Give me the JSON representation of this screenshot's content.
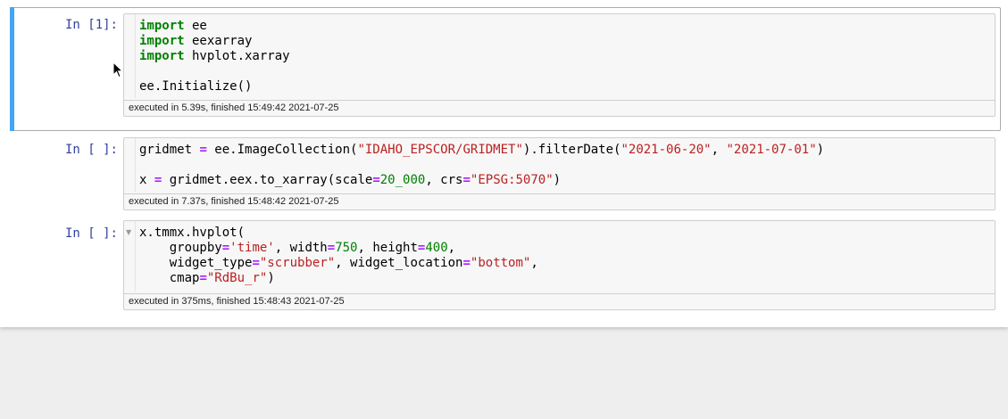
{
  "colors": {
    "prompt": "#303f9f",
    "keyword": "#008000",
    "operator": "#aa22ff",
    "string": "#ba2121",
    "number": "#008000",
    "selection_bar": "#42a5f5"
  },
  "cells": [
    {
      "prompt": "In [1]:",
      "selected": true,
      "lines": [
        [
          {
            "t": "import",
            "c": "kw"
          },
          {
            "t": " ee"
          }
        ],
        [
          {
            "t": "import",
            "c": "kw"
          },
          {
            "t": " eexarray"
          }
        ],
        [
          {
            "t": "import",
            "c": "kw"
          },
          {
            "t": " hvplot.xarray"
          }
        ],
        [],
        [
          {
            "t": "ee.Initialize()"
          }
        ]
      ],
      "exec_time": "executed in 5.39s, finished 15:49:42 2021-07-25"
    },
    {
      "prompt": "In [ ]:",
      "selected": false,
      "lines": [
        [
          {
            "t": "gridmet "
          },
          {
            "t": "=",
            "c": "op"
          },
          {
            "t": " ee.ImageCollection("
          },
          {
            "t": "\"IDAHO_EPSCOR/GRIDMET\"",
            "c": "str"
          },
          {
            "t": ").filterDate("
          },
          {
            "t": "\"2021-06-20\"",
            "c": "str"
          },
          {
            "t": ", "
          },
          {
            "t": "\"2021-07-01\"",
            "c": "str"
          },
          {
            "t": ")"
          }
        ],
        [],
        [
          {
            "t": "x "
          },
          {
            "t": "=",
            "c": "op"
          },
          {
            "t": " gridmet.eex.to_xarray(scale"
          },
          {
            "t": "=",
            "c": "op"
          },
          {
            "t": "20_000",
            "c": "num"
          },
          {
            "t": ", crs"
          },
          {
            "t": "=",
            "c": "op"
          },
          {
            "t": "\"EPSG:5070\"",
            "c": "str"
          },
          {
            "t": ")"
          }
        ]
      ],
      "exec_time": "executed in 7.37s, finished 15:48:42 2021-07-25"
    },
    {
      "prompt": "In [ ]:",
      "selected": false,
      "fold_marker": "▼",
      "lines": [
        [
          {
            "t": "x.tmmx.hvplot("
          }
        ],
        [
          {
            "t": "    groupby"
          },
          {
            "t": "=",
            "c": "op"
          },
          {
            "t": "'time'",
            "c": "str"
          },
          {
            "t": ", width"
          },
          {
            "t": "=",
            "c": "op"
          },
          {
            "t": "750",
            "c": "num"
          },
          {
            "t": ", height"
          },
          {
            "t": "=",
            "c": "op"
          },
          {
            "t": "400",
            "c": "num"
          },
          {
            "t": ","
          }
        ],
        [
          {
            "t": "    widget_type"
          },
          {
            "t": "=",
            "c": "op"
          },
          {
            "t": "\"scrubber\"",
            "c": "str"
          },
          {
            "t": ", widget_location"
          },
          {
            "t": "=",
            "c": "op"
          },
          {
            "t": "\"bottom\"",
            "c": "str"
          },
          {
            "t": ","
          }
        ],
        [
          {
            "t": "    cmap"
          },
          {
            "t": "=",
            "c": "op"
          },
          {
            "t": "\"RdBu_r\"",
            "c": "str"
          },
          {
            "t": ")"
          }
        ]
      ],
      "exec_time": "executed in 375ms, finished 15:48:43 2021-07-25"
    }
  ],
  "pointer": "mouse-cursor-icon"
}
